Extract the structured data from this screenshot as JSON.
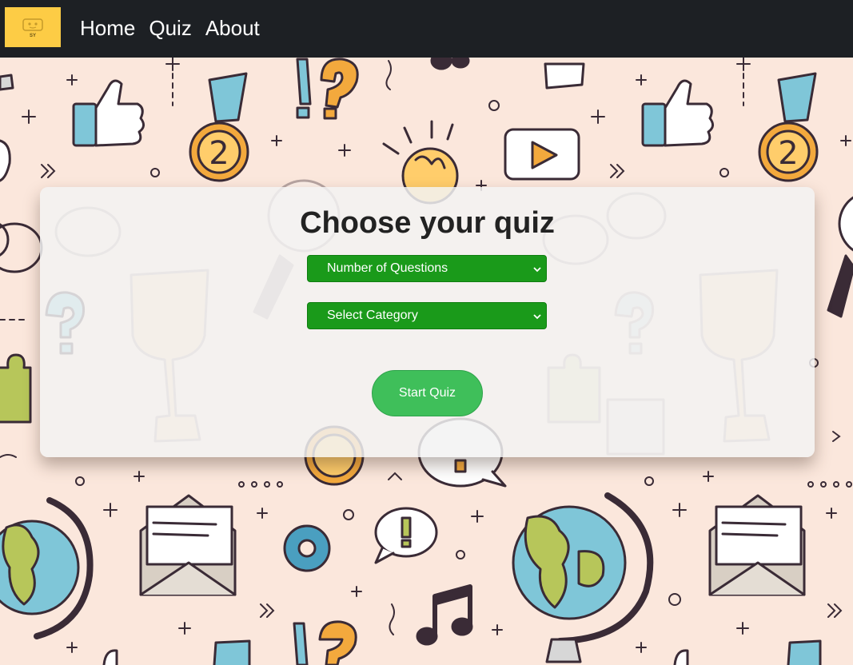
{
  "nav": {
    "logo_text": "SY",
    "links": [
      "Home",
      "Quiz",
      "About"
    ]
  },
  "card": {
    "title": "Choose your quiz",
    "questions_select": "Number of Questions",
    "category_select": "Select Category",
    "start_button": "Start Quiz"
  },
  "colors": {
    "navbar": "#1d2024",
    "logo": "#fdcc45",
    "background": "#fbe7dc",
    "select": "#1a9a1a",
    "button": "#3fbf5a"
  },
  "icons": [
    "thumbs-up-icon",
    "medal-icon",
    "question-mark-icon",
    "light-bulb-icon",
    "play-icon",
    "globe-icon",
    "envelope-icon",
    "gear-icon",
    "music-note-icon",
    "trophy-icon",
    "puzzle-icon",
    "magnifier-icon",
    "glasses-icon",
    "speech-bubble-icon"
  ]
}
